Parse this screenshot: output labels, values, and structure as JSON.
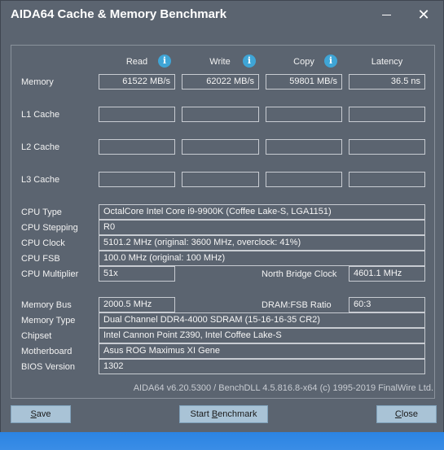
{
  "window": {
    "title": "AIDA64 Cache & Memory Benchmark",
    "minimize_glyph": "—",
    "close_glyph": "✕"
  },
  "columns": {
    "read": "Read",
    "write": "Write",
    "copy": "Copy",
    "latency": "Latency",
    "info_glyph": "i"
  },
  "rows": {
    "memory": {
      "label": "Memory",
      "read": "61522 MB/s",
      "write": "62022 MB/s",
      "copy": "59801 MB/s",
      "latency": "36.5 ns"
    },
    "l1": {
      "label": "L1 Cache",
      "read": "",
      "write": "",
      "copy": "",
      "latency": ""
    },
    "l2": {
      "label": "L2 Cache",
      "read": "",
      "write": "",
      "copy": "",
      "latency": ""
    },
    "l3": {
      "label": "L3 Cache",
      "read": "",
      "write": "",
      "copy": "",
      "latency": ""
    }
  },
  "cpu": {
    "type_label": "CPU Type",
    "type": "OctalCore Intel Core i9-9900K  (Coffee Lake-S, LGA1151)",
    "stepping_label": "CPU Stepping",
    "stepping": "R0",
    "clock_label": "CPU Clock",
    "clock": "5101.2 MHz  (original: 3600 MHz, overclock: 41%)",
    "fsb_label": "CPU FSB",
    "fsb": "100.0 MHz  (original: 100 MHz)",
    "multiplier_label": "CPU Multiplier",
    "multiplier": "51x",
    "nb_clock_label": "North Bridge Clock",
    "nb_clock": "4601.1 MHz"
  },
  "memory_info": {
    "bus_label": "Memory Bus",
    "bus": "2000.5 MHz",
    "ratio_label": "DRAM:FSB Ratio",
    "ratio": "60:3",
    "type_label": "Memory Type",
    "type": "Dual Channel DDR4-4000 SDRAM  (15-16-16-35 CR2)",
    "chipset_label": "Chipset",
    "chipset": "Intel Cannon Point Z390, Intel Coffee Lake-S",
    "motherboard_label": "Motherboard",
    "motherboard": "Asus ROG Maximus XI Gene",
    "bios_label": "BIOS Version",
    "bios": "1302"
  },
  "footer": "AIDA64 v6.20.5300 / BenchDLL 4.5.816.8-x64  (c) 1995-2019 FinalWire Ltd.",
  "buttons": {
    "save_u": "S",
    "save_rest": "ave",
    "start_pre": "Start ",
    "start_u": "B",
    "start_rest": "enchmark",
    "close_u": "C",
    "close_rest": "lose"
  }
}
